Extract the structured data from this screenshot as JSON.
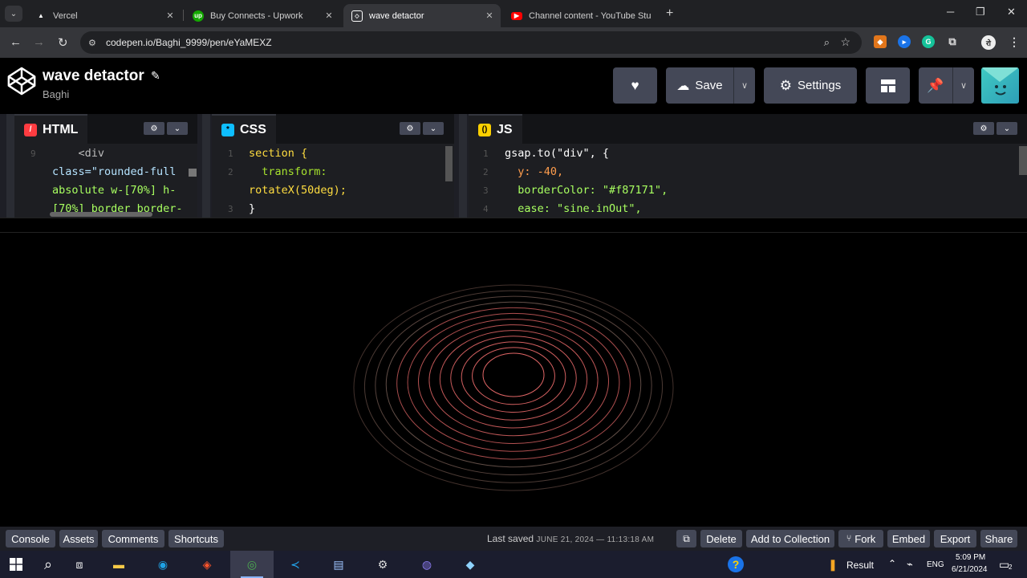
{
  "browser": {
    "tabs": [
      {
        "title": "Vercel",
        "icon": "vercel-icon",
        "color": "#ffffff"
      },
      {
        "title": "Buy Connects - Upwork",
        "icon": "upwork-icon",
        "color": "#14a800"
      },
      {
        "title": "wave detactor",
        "icon": "codepen-icon",
        "color": "#ffffff",
        "active": true
      },
      {
        "title": "Channel content - YouTube Stu",
        "icon": "youtube-icon",
        "color": "#ff0000"
      }
    ],
    "url": "codepen.io/Baghi_9999/pen/eYaMEXZ"
  },
  "header": {
    "title": "wave detactor",
    "author": "Baghi",
    "save_label": "Save",
    "settings_label": "Settings"
  },
  "editors": {
    "html": {
      "label": "HTML",
      "lines": [
        {
          "num": "9",
          "text": "    <div"
        },
        {
          "num": "",
          "text": "class=\"rounded-full"
        },
        {
          "num": "",
          "text": "absolute w-[70%] h-"
        },
        {
          "num": "",
          "text": "[70%] border border-"
        }
      ]
    },
    "css": {
      "label": "CSS",
      "lines": [
        {
          "num": "1",
          "text": "section {"
        },
        {
          "num": "2",
          "text": "  transform:"
        },
        {
          "num": "",
          "text": "rotateX(50deg);"
        },
        {
          "num": "3",
          "text": "}"
        }
      ]
    },
    "js": {
      "label": "JS",
      "lines": [
        {
          "num": "1",
          "text": "gsap.to(\"div\", {"
        },
        {
          "num": "2",
          "text": "  y: -40,"
        },
        {
          "num": "3",
          "text": "  borderColor: \"#f87171\","
        },
        {
          "num": "4",
          "text": "  ease: \"sine.inOut\","
        }
      ]
    }
  },
  "footer": {
    "left": [
      "Console",
      "Assets",
      "Comments",
      "Shortcuts"
    ],
    "last_saved_label": "Last saved",
    "last_saved_date": "JUNE 21, 2024 — 11:13:18 AM",
    "right": [
      "Delete",
      "Add to Collection",
      "Fork",
      "Embed",
      "Export",
      "Share"
    ]
  },
  "taskbar": {
    "result_label": "Result",
    "lang": "ENG",
    "time": "5:09 PM",
    "date": "6/21/2024",
    "notif_count": "2"
  },
  "colors": {
    "ring_stroke": "#f87171",
    "codepen_button": "#444857",
    "editor_bg": "#1d1e22"
  }
}
